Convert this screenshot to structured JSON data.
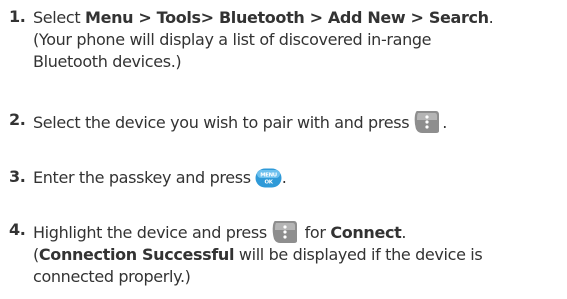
{
  "steps": [
    {
      "number": "1.",
      "text_before": "Select ",
      "bold": "Menu > Tools> Bluetooth > Add New > Search",
      "text_after": ".",
      "line2": "(Your phone will display a list of discovered in-range",
      "line3": "Bluetooth devices.)"
    },
    {
      "number": "2.",
      "text_before": "Select the device you wish to pair with and press",
      "text_after": ".",
      "key_icon": "side-softkey-icon"
    },
    {
      "number": "3.",
      "text_before": "Enter the passkey and press",
      "text_after": ".",
      "key_icon": "menu-ok-key-icon",
      "key_label_top": "MENU",
      "key_label_bottom": "OK"
    },
    {
      "number": "4.",
      "text_before": "Highlight the device and press",
      "text_mid": " for ",
      "bold": "Connect",
      "text_after": ".",
      "key_icon": "side-softkey-icon",
      "line2_open": "(",
      "line2_bold": "Connection Successful",
      "line2_rest": " will be displayed if the device is",
      "line3": "connected properly.)"
    }
  ],
  "colors": {
    "text": "#333333",
    "key_gray": "#8a8a8a",
    "key_blue": "#3aa6e0"
  }
}
